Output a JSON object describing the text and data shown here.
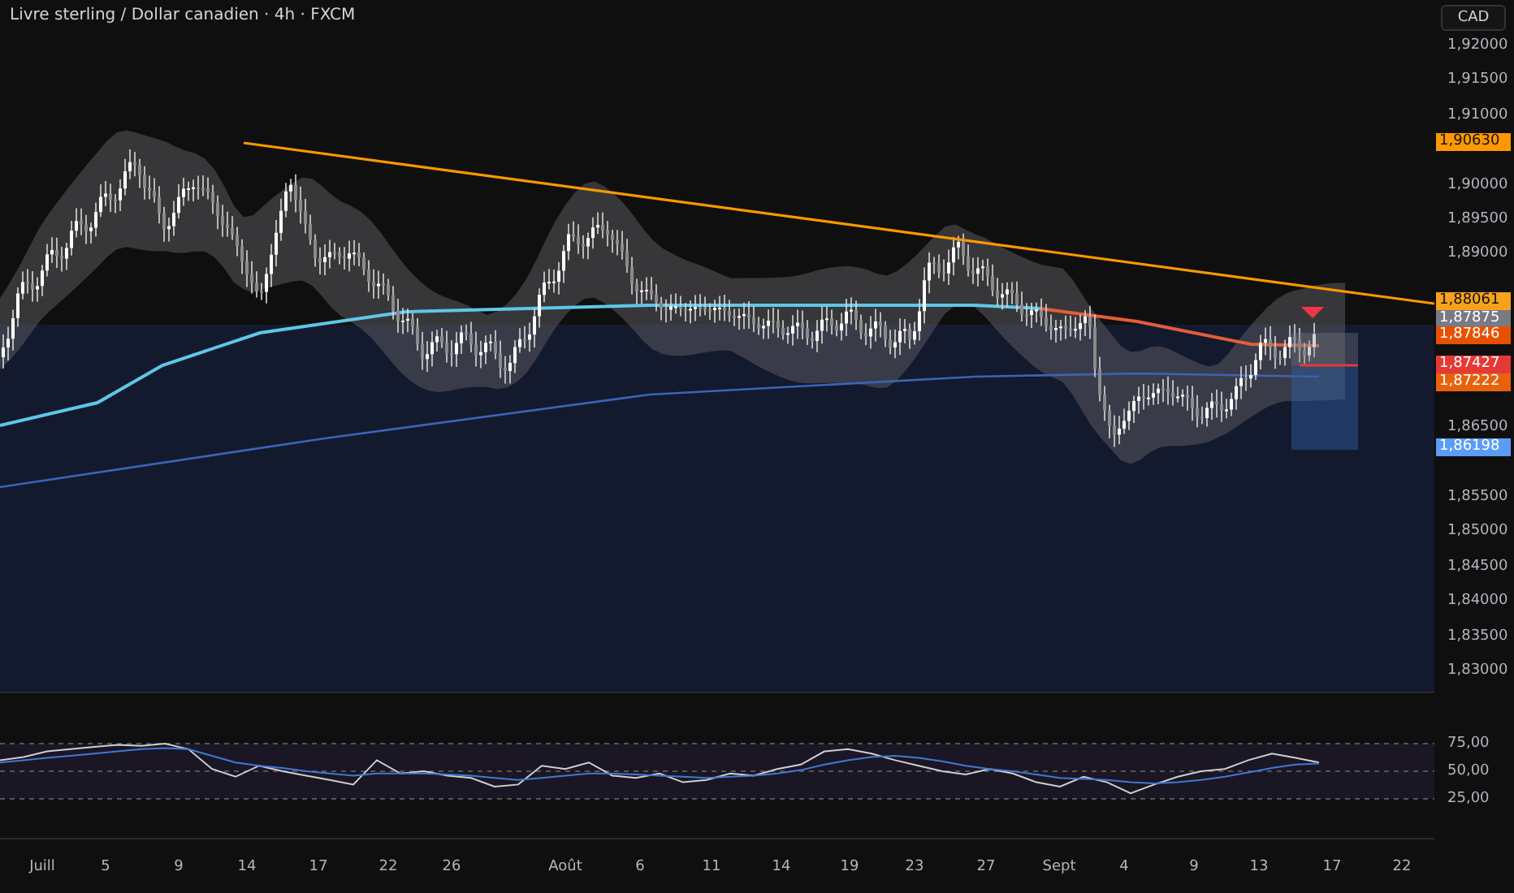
{
  "header": {
    "title": "Livre sterling / Dollar canadien · 4h · FXCM"
  },
  "currency_button": {
    "label": "CAD"
  },
  "price_axis": {
    "ticks": [
      "1,92000",
      "1,91500",
      "1,91000",
      "1,90000",
      "1,89500",
      "1,89000",
      "1,86500",
      "1,85500",
      "1,85000",
      "1,84500",
      "1,84000",
      "1,83500",
      "1,83000"
    ]
  },
  "price_tags": [
    {
      "value": "1,90630",
      "color": "#ff9800"
    },
    {
      "value": "1,88061",
      "color": "#f7a21b"
    },
    {
      "value": "1,87875",
      "color": "#787b86"
    },
    {
      "value": "1,87846",
      "color": "#e65100"
    },
    {
      "value": "1,87427",
      "color": "#e53935"
    },
    {
      "value": "1,87222",
      "color": "#e8620c"
    },
    {
      "value": "1,86198",
      "color": "#5b9cf6"
    }
  ],
  "rsi_panel": {
    "chart_data": {
      "type": "line",
      "ylim": [
        25,
        75
      ],
      "grid": true,
      "yticks": [
        {
          "value": 75,
          "label": "75,00"
        },
        {
          "value": 50,
          "label": "50,00"
        },
        {
          "value": 25,
          "label": "25,00"
        }
      ],
      "series": [
        {
          "color": "#cfcfcf",
          "values": [
            60,
            63,
            68,
            70,
            72,
            74,
            73,
            75,
            70,
            52,
            45,
            55,
            50,
            46,
            42,
            38,
            60,
            48,
            50,
            46,
            44,
            36,
            38,
            55,
            52,
            58,
            46,
            44,
            48,
            40,
            42,
            48,
            46,
            52,
            56,
            68,
            70,
            66,
            60,
            55,
            50,
            47,
            52,
            48,
            40,
            36,
            45,
            40,
            30,
            38,
            45,
            50,
            52,
            60,
            66,
            62,
            58
          ]
        },
        {
          "color": "#3f78d6",
          "values": [
            58,
            60,
            62,
            64,
            66,
            68,
            70,
            71,
            70,
            64,
            58,
            55,
            53,
            50,
            48,
            46,
            48,
            48,
            48,
            47,
            46,
            44,
            42,
            44,
            46,
            48,
            48,
            47,
            46,
            45,
            44,
            45,
            46,
            48,
            51,
            56,
            60,
            63,
            64,
            62,
            59,
            55,
            52,
            50,
            47,
            44,
            43,
            42,
            40,
            39,
            40,
            42,
            45,
            49,
            53,
            56,
            57
          ]
        }
      ]
    }
  },
  "time_axis": {
    "labels": [
      "Juill",
      "5",
      "9",
      "14",
      "17",
      "22",
      "26",
      "Août",
      "6",
      "11",
      "14",
      "19",
      "23",
      "27",
      "Sept",
      "4",
      "9",
      "13",
      "17",
      "22"
    ]
  }
}
